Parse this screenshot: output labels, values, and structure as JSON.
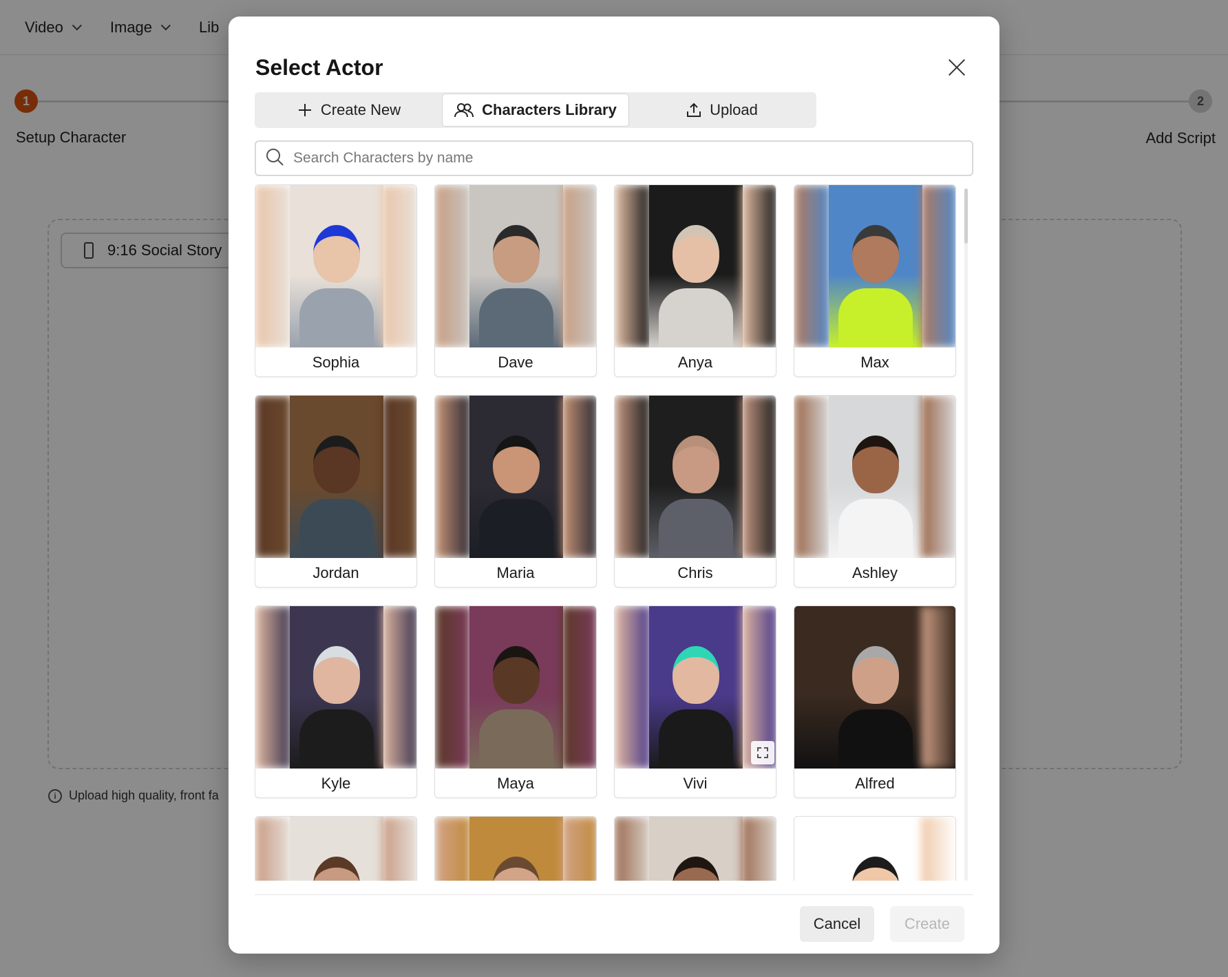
{
  "nav": {
    "items": [
      "Video",
      "Image",
      "Lib"
    ]
  },
  "stepper": {
    "step1": {
      "num": "1",
      "label": "Setup Character"
    },
    "step2": {
      "num": "2",
      "label": "Add Script"
    }
  },
  "canvas": {
    "ratio_label": "9:16  Social Story",
    "hint": "Upload high quality, front fa"
  },
  "modal": {
    "title": "Select Actor",
    "tabs": [
      {
        "label": "Create New",
        "icon": "plus-icon"
      },
      {
        "label": "Characters Library",
        "icon": "users-icon"
      },
      {
        "label": "Upload",
        "icon": "upload-icon"
      }
    ],
    "active_tab": "Characters Library",
    "search_placeholder": "Search Characters by name",
    "cancel_label": "Cancel",
    "create_label": "Create"
  },
  "characters": [
    {
      "name": "Sophia",
      "bg": "#e9e1d9",
      "skin": "#e8c4a8",
      "hair": "#1e38d8",
      "top": "#9aa2ad"
    },
    {
      "name": "Dave",
      "bg": "#c9c6c2",
      "skin": "#c79c80",
      "hair": "#2a2a2a",
      "top": "#5c6a78"
    },
    {
      "name": "Anya",
      "bg": "#1b1b1b",
      "skin": "#e6c0a6",
      "hair": "#d2c4b4",
      "top": "#d6d3cf"
    },
    {
      "name": "Max",
      "bg": "#4f86c8",
      "skin": "#b07a5e",
      "hair": "#3a3a3a",
      "top": "#c7f02a"
    },
    {
      "name": "Jordan",
      "bg": "#6a4a2e",
      "skin": "#5a3624",
      "hair": "#1c1c1c",
      "top": "#3c4a56"
    },
    {
      "name": "Maria",
      "bg": "#2c2a33",
      "skin": "#c99576",
      "hair": "#151515",
      "top": "#1c1e26"
    },
    {
      "name": "Chris",
      "bg": "#1e1e1e",
      "skin": "#c89a84",
      "hair": "#b8907a",
      "top": "#5d6068"
    },
    {
      "name": "Ashley",
      "bg": "#d6d8da",
      "skin": "#9a6547",
      "hair": "#1f1510",
      "top": "#f4f4f4"
    },
    {
      "name": "Kyle",
      "bg": "#3c3650",
      "skin": "#e0b6a0",
      "hair": "#d8dde2",
      "top": "#1c1c1c"
    },
    {
      "name": "Maya",
      "bg": "#7a3a5a",
      "skin": "#5a3826",
      "hair": "#1b1512",
      "top": "#7a6a5a"
    },
    {
      "name": "Vivi",
      "bg": "#4a3a8a",
      "skin": "#e2b8a0",
      "hair": "#2ed6b6",
      "top": "#1a1a1a"
    },
    {
      "name": "Alfred",
      "bg": "#3a2a20",
      "skin": "#cfa088",
      "hair": "#a8a8a8",
      "top": "#111111"
    },
    {
      "name": "",
      "bg": "#e6e0da",
      "skin": "#c89a82",
      "hair": "#5a3a26",
      "top": "#e6e0da"
    },
    {
      "name": "",
      "bg": "#c08a3c",
      "skin": "#d2a488",
      "hair": "#6a4a30",
      "top": "#3a6a2a"
    },
    {
      "name": "",
      "bg": "#d8cfc6",
      "skin": "#9a6a50",
      "hair": "#1f1611",
      "top": "#d8cfc6"
    },
    {
      "name": "",
      "bg": "#ffffff",
      "skin": "#f0c8a8",
      "hair": "#1c1c1c",
      "top": "#ff8a1c"
    }
  ]
}
